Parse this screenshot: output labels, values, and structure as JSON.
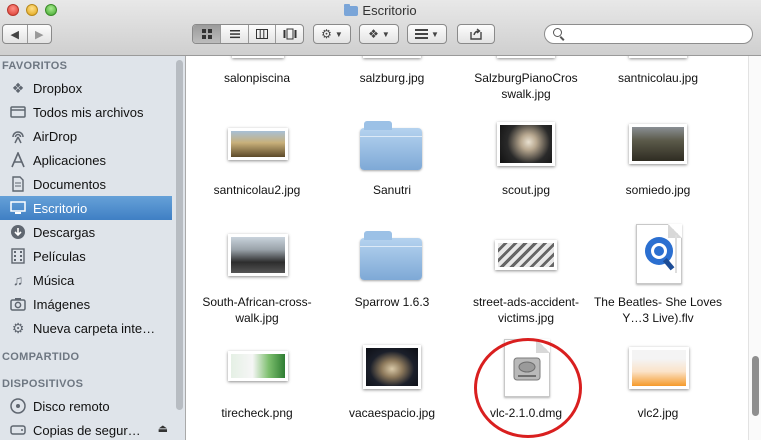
{
  "window": {
    "title": "Escritorio"
  },
  "toolbar": {
    "back_icon": "back-icon",
    "forward_icon": "forward-icon",
    "view_modes": [
      "icon-view",
      "list-view",
      "column-view",
      "coverflow-view"
    ],
    "search": {
      "placeholder": ""
    }
  },
  "sidebar": {
    "sections": [
      {
        "header": "FAVORITOS",
        "items": [
          {
            "label": "Dropbox",
            "icon": "dropbox-icon"
          },
          {
            "label": "Todos mis archivos",
            "icon": "all-files-icon"
          },
          {
            "label": "AirDrop",
            "icon": "airdrop-icon"
          },
          {
            "label": "Aplicaciones",
            "icon": "applications-icon"
          },
          {
            "label": "Documentos",
            "icon": "documents-icon"
          },
          {
            "label": "Escritorio",
            "icon": "desktop-icon",
            "selected": true
          },
          {
            "label": "Descargas",
            "icon": "downloads-icon"
          },
          {
            "label": "Películas",
            "icon": "movies-icon"
          },
          {
            "label": "Música",
            "icon": "music-icon"
          },
          {
            "label": "Imágenes",
            "icon": "pictures-icon"
          },
          {
            "label": "Nueva carpeta inte…",
            "icon": "gear-icon"
          }
        ]
      },
      {
        "header": "COMPARTIDO",
        "items": []
      },
      {
        "header": "DISPOSITIVOS",
        "items": [
          {
            "label": "Disco remoto",
            "icon": "disk-icon"
          },
          {
            "label": "Copias de segur…",
            "icon": "disk-icon",
            "eject": "⏏"
          }
        ]
      }
    ]
  },
  "files": [
    {
      "name": "salonpiscina",
      "kind": "partial"
    },
    {
      "name": "salzburg.jpg",
      "kind": "partial"
    },
    {
      "name": "SalzburgPianoCros swalk.jpg",
      "kind": "partial"
    },
    {
      "name": "santnicolau.jpg",
      "kind": "partial"
    },
    {
      "name": "santnicolau2.jpg",
      "kind": "photo"
    },
    {
      "name": "Sanutri",
      "kind": "folder"
    },
    {
      "name": "scout.jpg",
      "kind": "photo"
    },
    {
      "name": "somiedo.jpg",
      "kind": "photo"
    },
    {
      "name": "South-African-cross-walk.jpg",
      "kind": "photo"
    },
    {
      "name": "Sparrow 1.6.3",
      "kind": "folder"
    },
    {
      "name": "street-ads-accident-victims.jpg",
      "kind": "photo"
    },
    {
      "name": "The Beatles- She Loves Y…3 Live).flv",
      "kind": "video"
    },
    {
      "name": "tirecheck.png",
      "kind": "photo"
    },
    {
      "name": "vacaespacio.jpg",
      "kind": "photo"
    },
    {
      "name": "vlc-2.1.0.dmg",
      "kind": "disk-image",
      "highlighted": true
    },
    {
      "name": "vlc2.jpg",
      "kind": "photo"
    }
  ]
}
